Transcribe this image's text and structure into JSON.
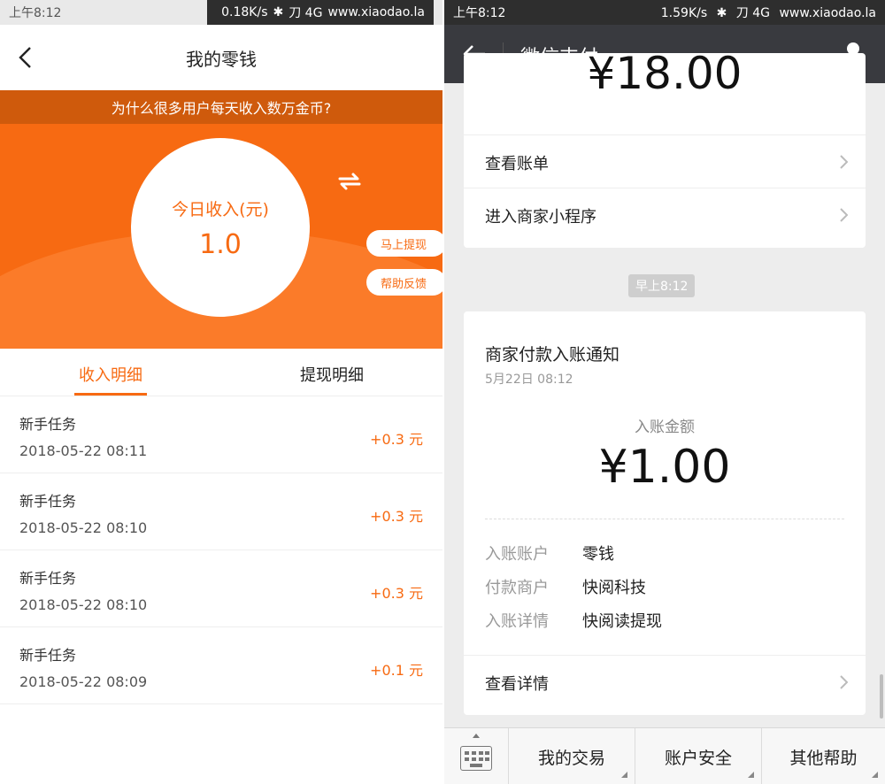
{
  "left": {
    "status_bar": {
      "time": "上午8:12",
      "net_speed": "0.18K/s",
      "carrier": "刀 4G",
      "watermark": "www.xiaodao.la"
    },
    "nav": {
      "title": "我的零钱",
      "back_icon": "chevron-left-icon"
    },
    "banner": "为什么很多用户每天收入数万金币?",
    "income": {
      "label": "今日收入(元)",
      "value": "1.0"
    },
    "buttons": {
      "withdraw": "马上提现",
      "feedback": "帮助反馈"
    },
    "tabs": [
      {
        "label": "收入明细",
        "active": true
      },
      {
        "label": "提现明细",
        "active": false
      }
    ],
    "records": [
      {
        "name": "新手任务",
        "time": "2018-05-22 08:11",
        "amount": "+0.3 元"
      },
      {
        "name": "新手任务",
        "time": "2018-05-22 08:10",
        "amount": "+0.3 元"
      },
      {
        "name": "新手任务",
        "time": "2018-05-22 08:10",
        "amount": "+0.3 元"
      },
      {
        "name": "新手任务",
        "time": "2018-05-22 08:09",
        "amount": "+0.1 元"
      }
    ],
    "accent_color": "#f76a12"
  },
  "right": {
    "status_bar": {
      "time": "上午8:12",
      "net_speed": "1.59K/s",
      "carrier": "刀 4G",
      "watermark": "www.xiaodao.la"
    },
    "nav": {
      "title": "微信支付",
      "back_icon": "arrow-left-icon",
      "profile_icon": "person-icon"
    },
    "previous_card": {
      "amount_partial": "¥18.00",
      "rows": [
        "查看账单",
        "进入商家小程序"
      ]
    },
    "timestamp": "早上8:12",
    "notice": {
      "title": "商家付款入账通知",
      "date": "5月22日  08:12",
      "amount_label": "入账金额",
      "amount": "¥1.00",
      "details": [
        {
          "key": "入账账户",
          "value": "零钱"
        },
        {
          "key": "付款商户",
          "value": "快阅科技"
        },
        {
          "key": "入账详情",
          "value": "快阅读提现"
        }
      ],
      "view_detail": "查看详情"
    },
    "bottom_bar": {
      "keyboard_icon": "keyboard-icon",
      "tabs": [
        "我的交易",
        "账户安全",
        "其他帮助"
      ]
    },
    "nav_color": "#393a3f"
  }
}
